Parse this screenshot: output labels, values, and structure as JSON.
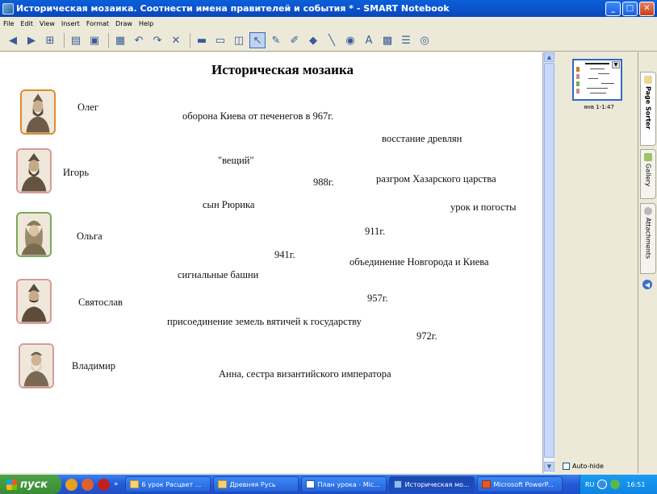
{
  "window": {
    "title": "Историческая мозаика. Соотнести имена правителей и события * - SMART Notebook",
    "minimize": "_",
    "maximize": "□",
    "close": "✕"
  },
  "menu": [
    "File",
    "Edit",
    "View",
    "Insert",
    "Format",
    "Draw",
    "Help"
  ],
  "toolbar": {
    "icons": [
      "back-icon",
      "forward-icon",
      "add-page-icon",
      "open-icon",
      "save-icon",
      "paste-icon",
      "undo-icon",
      "redo-icon",
      "delete-icon",
      "screen-shade-icon",
      "full-screen-icon",
      "capture-icon",
      "select-icon",
      "pen-icon",
      "highlighter-icon",
      "eraser-icon",
      "line-icon",
      "fill-icon",
      "text-icon",
      "properties-icon",
      "table-icon",
      "more-icon"
    ]
  },
  "slide": {
    "title": "Историческая мозаика",
    "rulers": [
      {
        "name": "Олег",
        "frame": "#e08a2a"
      },
      {
        "name": "Игорь",
        "frame": "#d89a9a"
      },
      {
        "name": "Ольга",
        "frame": "#7aa857"
      },
      {
        "name": "Святослав",
        "frame": "#d89a9a"
      },
      {
        "name": "Владимир",
        "frame": "#d89a9a"
      }
    ],
    "fragments": [
      "оборона Киева от печенегов в 967г.",
      "восстание древлян",
      "\"вещий\"",
      "988г.",
      "разгром Хазарского царства",
      "сын Рюрика",
      "урок и погосты",
      "911г.",
      "941г.",
      "объединение Новгорода и Киева",
      "сигнальные башни",
      "957г.",
      "присоединение земель вятичей к государству",
      "972г.",
      "Анна, сестра византийского императора"
    ]
  },
  "page_sorter": {
    "thumbnail_label": "янв 1-1:47",
    "autohide_label": "Auto-hide"
  },
  "side_tabs": [
    "Page Sorter",
    "Gallery",
    "Attachments"
  ],
  "taskbar": {
    "start_label": "пуск",
    "tasks": [
      {
        "label": "6 урок Расцвет ...",
        "active": false
      },
      {
        "label": "Древняя Русь",
        "active": false
      },
      {
        "label": "План урока - Mic...",
        "active": false
      },
      {
        "label": "Историческая мо...",
        "active": true
      },
      {
        "label": "Microsoft PowerP...",
        "active": false
      }
    ],
    "lang": "RU",
    "clock": "16:51"
  }
}
